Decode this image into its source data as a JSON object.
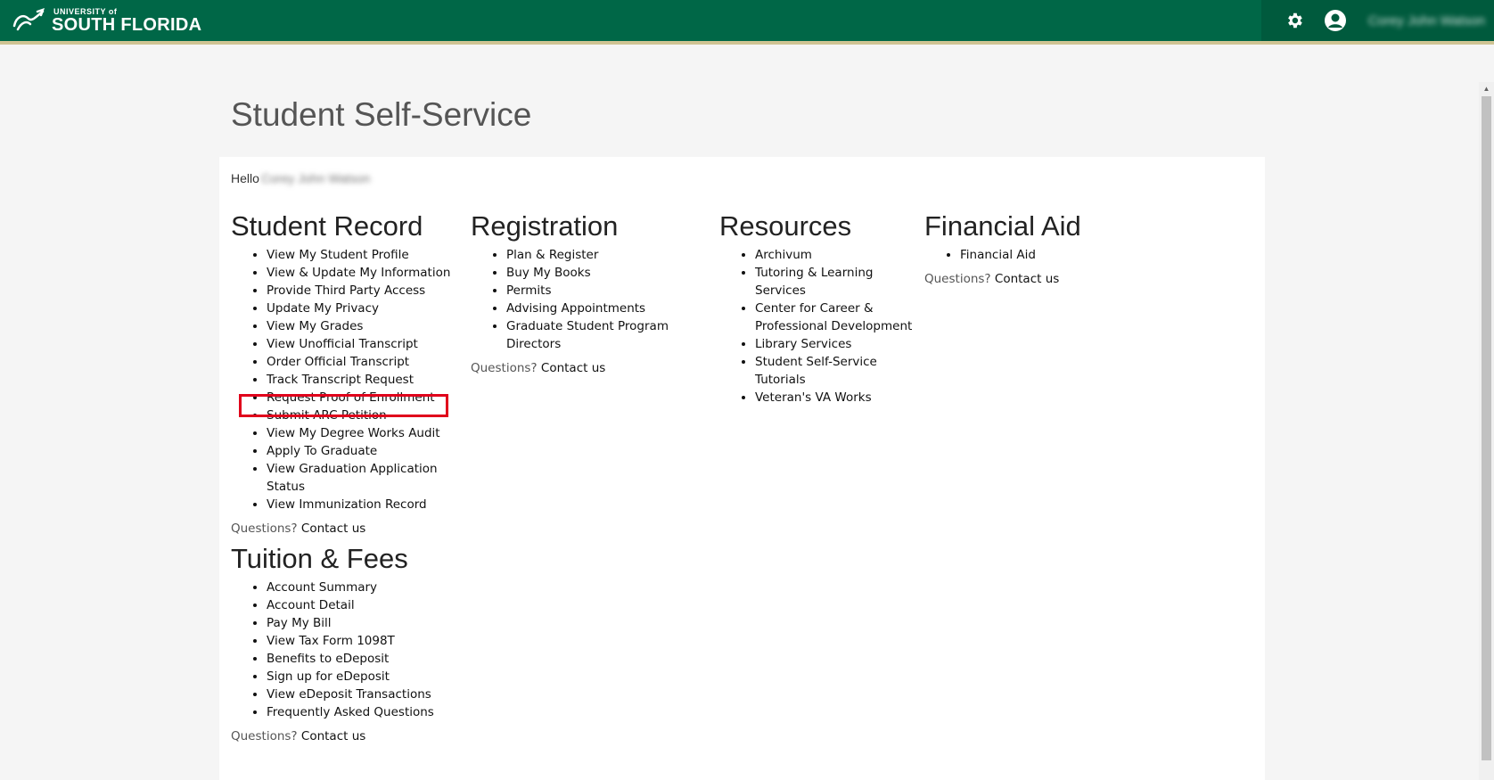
{
  "header": {
    "logo_small": "UNIVERSITY of",
    "logo_big": "SOUTH FLORIDA",
    "user_name": "Corey John Watson",
    "brand_color": "#006747",
    "accent_color": "#cfc493"
  },
  "page": {
    "title": "Student Self-Service",
    "hello": "Hello",
    "hello_name": "Corey John Watson"
  },
  "student_record": {
    "heading": "Student Record",
    "items": [
      "View My Student Profile",
      "View & Update My Information",
      "Provide Third Party Access",
      "Update My Privacy",
      "View My Grades",
      "View Unofficial Transcript",
      "Order Official Transcript",
      "Track Transcript Request",
      "Request Proof of Enrollment",
      "Submit ARC Petition",
      "View My Degree Works Audit",
      "Apply To Graduate",
      "View Graduation Application Status",
      "View Immunization Record"
    ],
    "questions": "Questions?",
    "contact": "Contact us"
  },
  "registration": {
    "heading": "Registration",
    "items": [
      "Plan & Register",
      "Buy My Books",
      "Permits",
      "Advising Appointments",
      "Graduate Student Program Directors"
    ],
    "questions": "Questions?",
    "contact": "Contact us"
  },
  "resources": {
    "heading": "Resources",
    "items": [
      "Archivum",
      "Tutoring & Learning Services",
      "Center for Career & Professional Development",
      "Library Services",
      "Student Self-Service Tutorials",
      "Veteran's VA Works"
    ]
  },
  "financial_aid": {
    "heading": "Financial Aid",
    "items": [
      "Financial Aid"
    ],
    "questions": "Questions?",
    "contact": "Contact us"
  },
  "tuition_fees": {
    "heading": "Tuition & Fees",
    "items": [
      "Account Summary",
      "Account Detail",
      "Pay My Bill",
      "View Tax Form 1098T",
      "Benefits to eDeposit",
      "Sign up for eDeposit",
      "View eDeposit Transactions",
      "Frequently Asked Questions"
    ],
    "questions": "Questions?",
    "contact": "Contact us"
  },
  "annotation": {
    "highlight_color": "#e0001b"
  }
}
